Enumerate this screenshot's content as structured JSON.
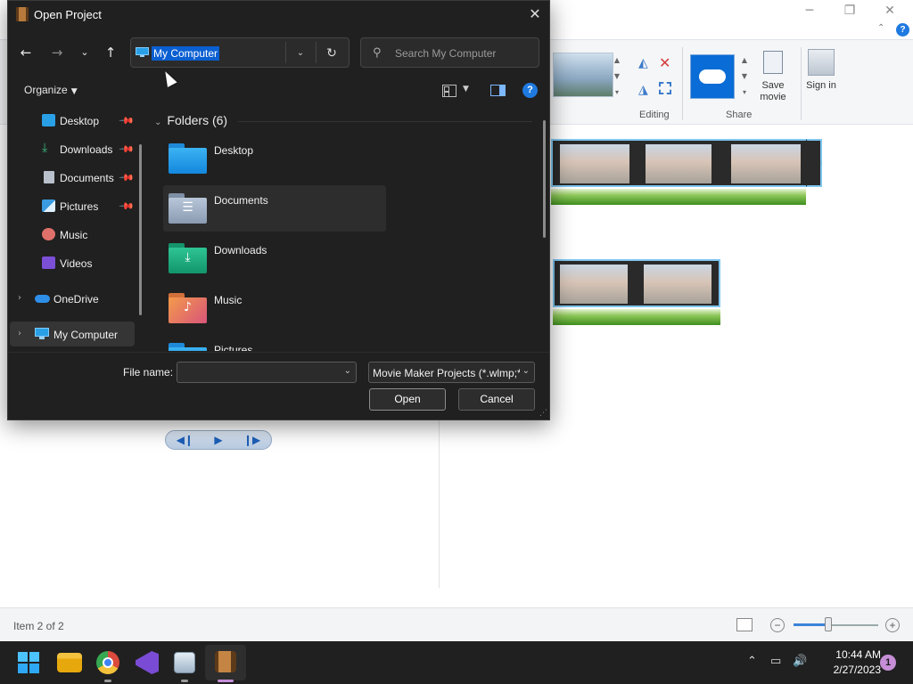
{
  "dialog": {
    "title": "Open Project",
    "address": "My Computer",
    "search_placeholder": "Search My Computer",
    "organize_label": "Organize",
    "sidebar": [
      {
        "label": "Desktop",
        "icon": "desktop-icon",
        "pinned": true
      },
      {
        "label": "Downloads",
        "icon": "downloads-icon",
        "pinned": true
      },
      {
        "label": "Documents",
        "icon": "documents-icon",
        "pinned": true
      },
      {
        "label": "Pictures",
        "icon": "pictures-icon",
        "pinned": true
      },
      {
        "label": "Music",
        "icon": "music-icon",
        "pinned": false
      },
      {
        "label": "Videos",
        "icon": "videos-icon",
        "pinned": false
      },
      {
        "label": "OneDrive",
        "icon": "onedrive-icon",
        "pinned": false
      },
      {
        "label": "My Computer",
        "icon": "computer-icon",
        "pinned": false
      }
    ],
    "group_header": "Folders (6)",
    "folders": [
      {
        "label": "Desktop",
        "icon": "desktop-folder-icon"
      },
      {
        "label": "Documents",
        "icon": "documents-folder-icon"
      },
      {
        "label": "Downloads",
        "icon": "downloads-folder-icon"
      },
      {
        "label": "Music",
        "icon": "music-folder-icon"
      },
      {
        "label": "Pictures",
        "icon": "pictures-folder-icon"
      }
    ],
    "file_name_label": "File name:",
    "file_name_value": "",
    "file_type": "Movie Maker Projects (*.wlmp;*",
    "open_label": "Open",
    "cancel_label": "Cancel"
  },
  "background_app": {
    "ribbon_groups": [
      "Editing",
      "Share"
    ],
    "save_movie_label": "Save movie",
    "sign_in_label": "Sign in",
    "status_text": "Item 2 of 2"
  },
  "taskbar": {
    "time": "10:44 AM",
    "date": "2/27/2023",
    "notifications": "1"
  },
  "colors": {
    "dialog_bg": "#202020",
    "selection": "#0a5fd1",
    "accent": "#1f7ae0"
  }
}
